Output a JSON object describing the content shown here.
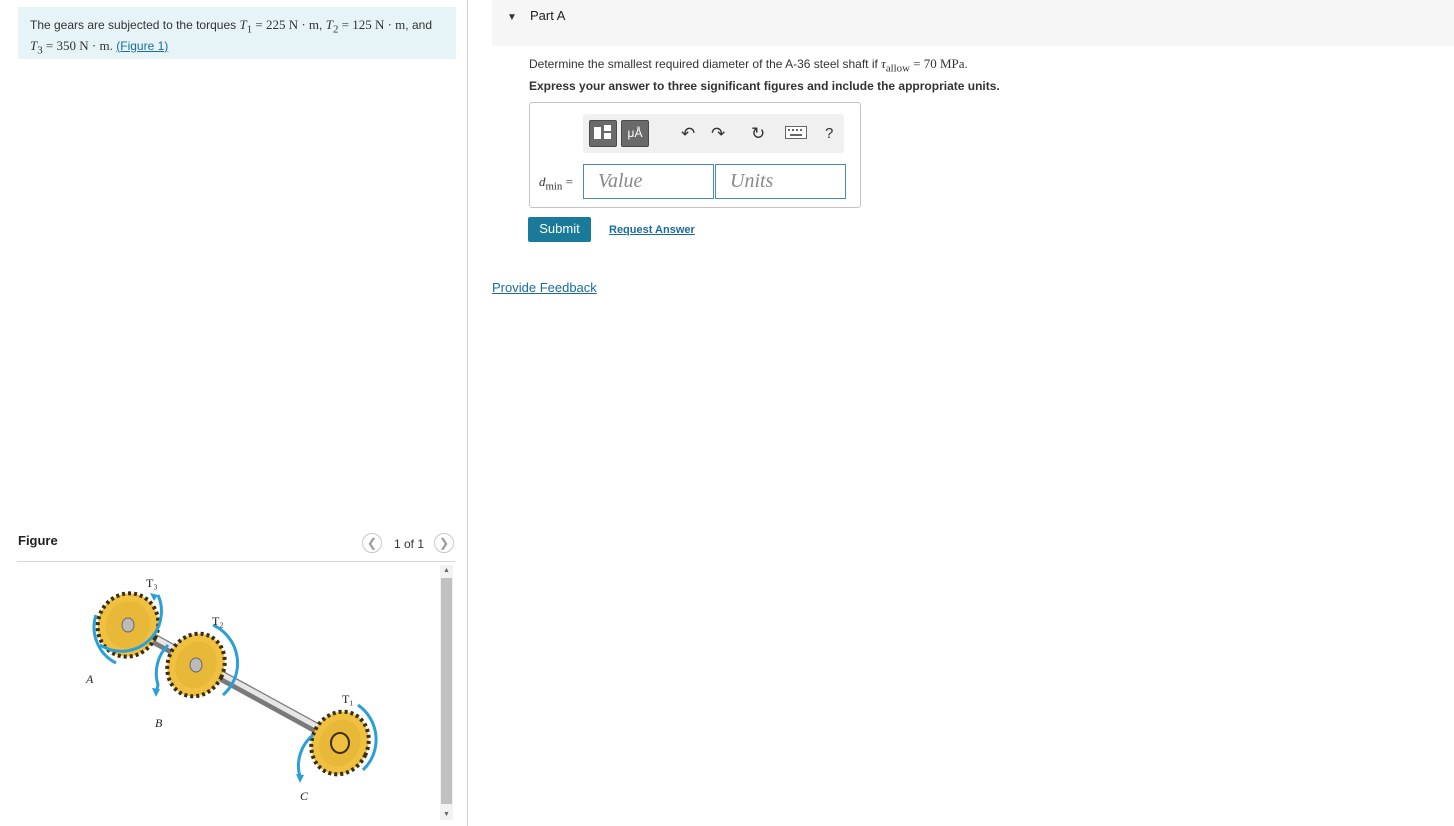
{
  "problem": {
    "prefix": "The gears are subjected to the torques ",
    "t1_sym": "T",
    "t1_sub": "1",
    "t1_value": " = 225 N · m",
    "t2_sym": "T",
    "t2_sub": "2",
    "t2_value": " = 125 N · m",
    "and": ", and",
    "t3_sym": "T",
    "t3_sub": "3",
    "t3_value": " = 350 N · m",
    "period": ".",
    "figure_link": "(Figure 1)"
  },
  "figure": {
    "title": "Figure",
    "pager": "1 of 1",
    "labels": {
      "t3": "T₃",
      "t2": "T₂",
      "t1": "T₁",
      "a": "A",
      "b": "B",
      "c": "C"
    }
  },
  "part": {
    "title": "Part A",
    "question_prefix": "Determine the smallest required diameter of the A-36 steel shaft if ",
    "tau_sym": "τ",
    "tau_sub": "allow",
    "tau_value": " = 70 MPa",
    "question_suffix": ".",
    "instruction": "Express your answer to three significant figures and include the appropriate units."
  },
  "answer": {
    "label_sym": "d",
    "label_sub": "min",
    "label_eq": " =",
    "value_placeholder": "Value",
    "units_placeholder": "Units",
    "toolbar": {
      "units_tile": "μÅ",
      "help": "?"
    }
  },
  "actions": {
    "submit": "Submit",
    "request_answer": "Request Answer",
    "provide_feedback": "Provide Feedback"
  },
  "colors": {
    "problem_bg": "#e6f4f7",
    "link": "#1a6b9e",
    "submit_bg": "#1a7a9a",
    "gear": "#f0c040",
    "torque_arrow": "#2a9fd8"
  }
}
